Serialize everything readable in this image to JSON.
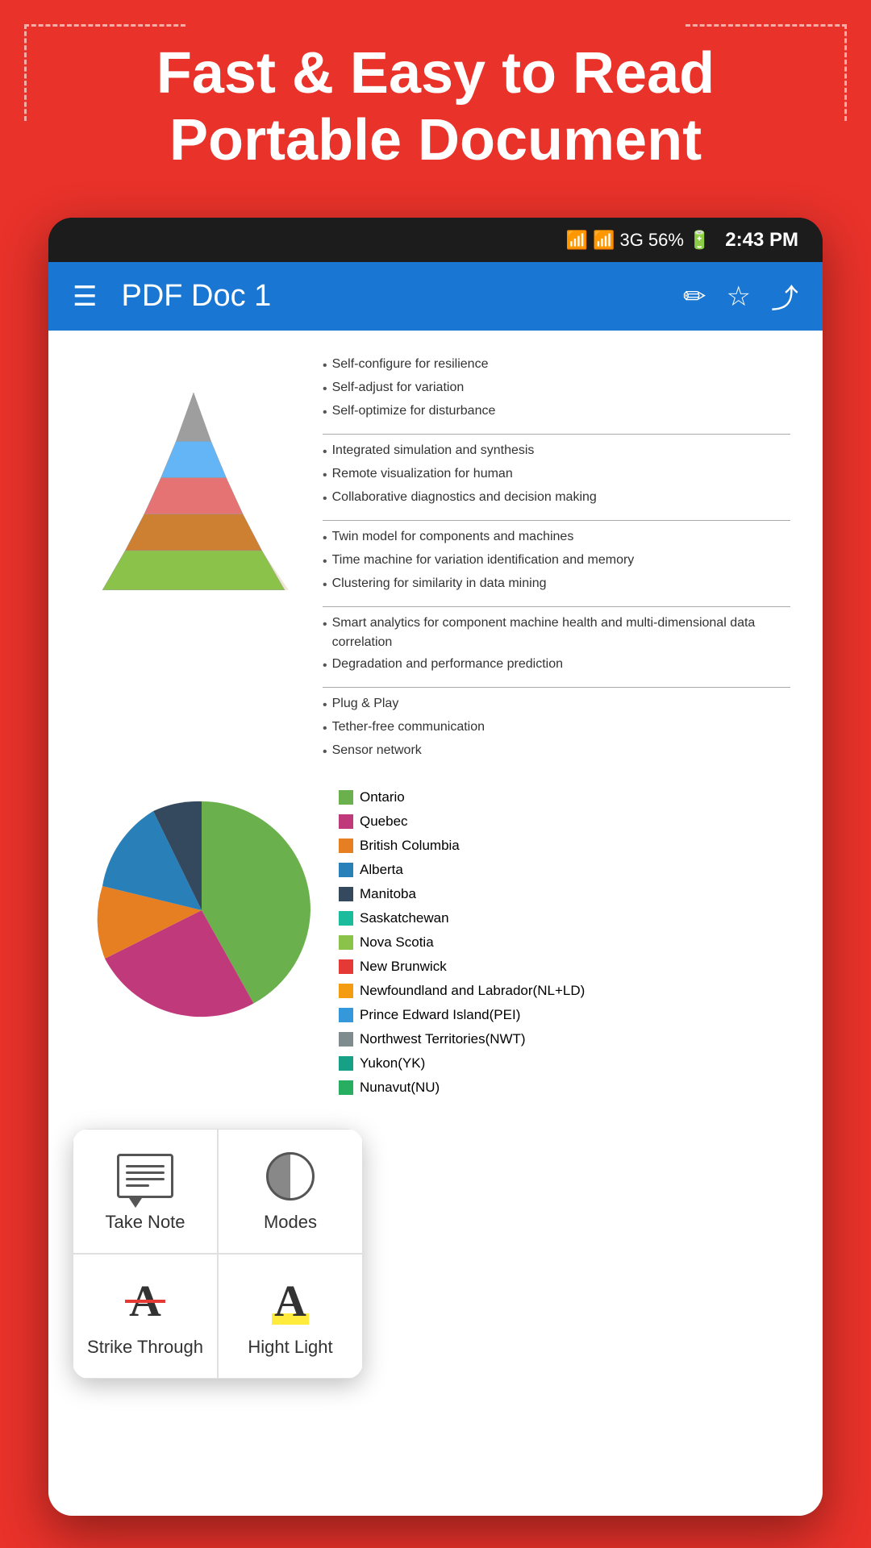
{
  "header": {
    "title": "Fast & Easy to Read Portable Document"
  },
  "statusBar": {
    "battery": "56%",
    "time": "2:43 PM",
    "signal": "3G"
  },
  "appBar": {
    "title": "PDF Doc 1",
    "editIcon": "✏",
    "starIcon": "☆",
    "shareIcon": "⤴"
  },
  "pyramid": {
    "levels": [
      {
        "bullets": [
          "Self-configure for resilience",
          "Self-adjust for variation",
          "Self-optimize for disturbance"
        ]
      },
      {
        "bullets": [
          "Integrated simulation and synthesis",
          "Remote visualization for human",
          "Collaborative diagnostics and decision making"
        ]
      },
      {
        "bullets": [
          "Twin model for components and machines",
          "Time machine for variation identification and memory",
          "Clustering for similarity in data mining"
        ]
      },
      {
        "bullets": [
          "Smart analytics for component machine health and multi-dimensional data correlation",
          "Degradation and performance prediction"
        ]
      },
      {
        "bullets": [
          "Plug & Play",
          "Tether-free communication",
          "Sensor network"
        ]
      }
    ]
  },
  "legend": {
    "items": [
      {
        "label": "Ontario",
        "color": "#6ab04c"
      },
      {
        "label": "Quebec",
        "color": "#c0392b"
      },
      {
        "label": "British Columbia",
        "color": "#e67e22"
      },
      {
        "label": "Alberta",
        "color": "#2980b9"
      },
      {
        "label": "Manitoba",
        "color": "#34495e"
      },
      {
        "label": "Saskatchewan",
        "color": "#1abc9c"
      },
      {
        "label": "Nova Scotia",
        "color": "#8bc34a"
      },
      {
        "label": "New Brunwick",
        "color": "#e53935"
      },
      {
        "label": "Newfoundland and Labrador(NL+LD)",
        "color": "#f39c12"
      },
      {
        "label": "Prince Edward Island(PEI)",
        "color": "#3498db"
      },
      {
        "label": "Northwest Territories(NWT)",
        "color": "#7f8c8d"
      },
      {
        "label": "Yukon(YK)",
        "color": "#16a085"
      },
      {
        "label": "Nunavut(NU)",
        "color": "#27ae60"
      }
    ]
  },
  "popup": {
    "items": [
      {
        "id": "take-note",
        "label": "Take Note"
      },
      {
        "id": "modes",
        "label": "Modes"
      },
      {
        "id": "strike-through",
        "label": "Strike Through"
      },
      {
        "id": "highlight",
        "label": "Hight Light"
      }
    ]
  }
}
